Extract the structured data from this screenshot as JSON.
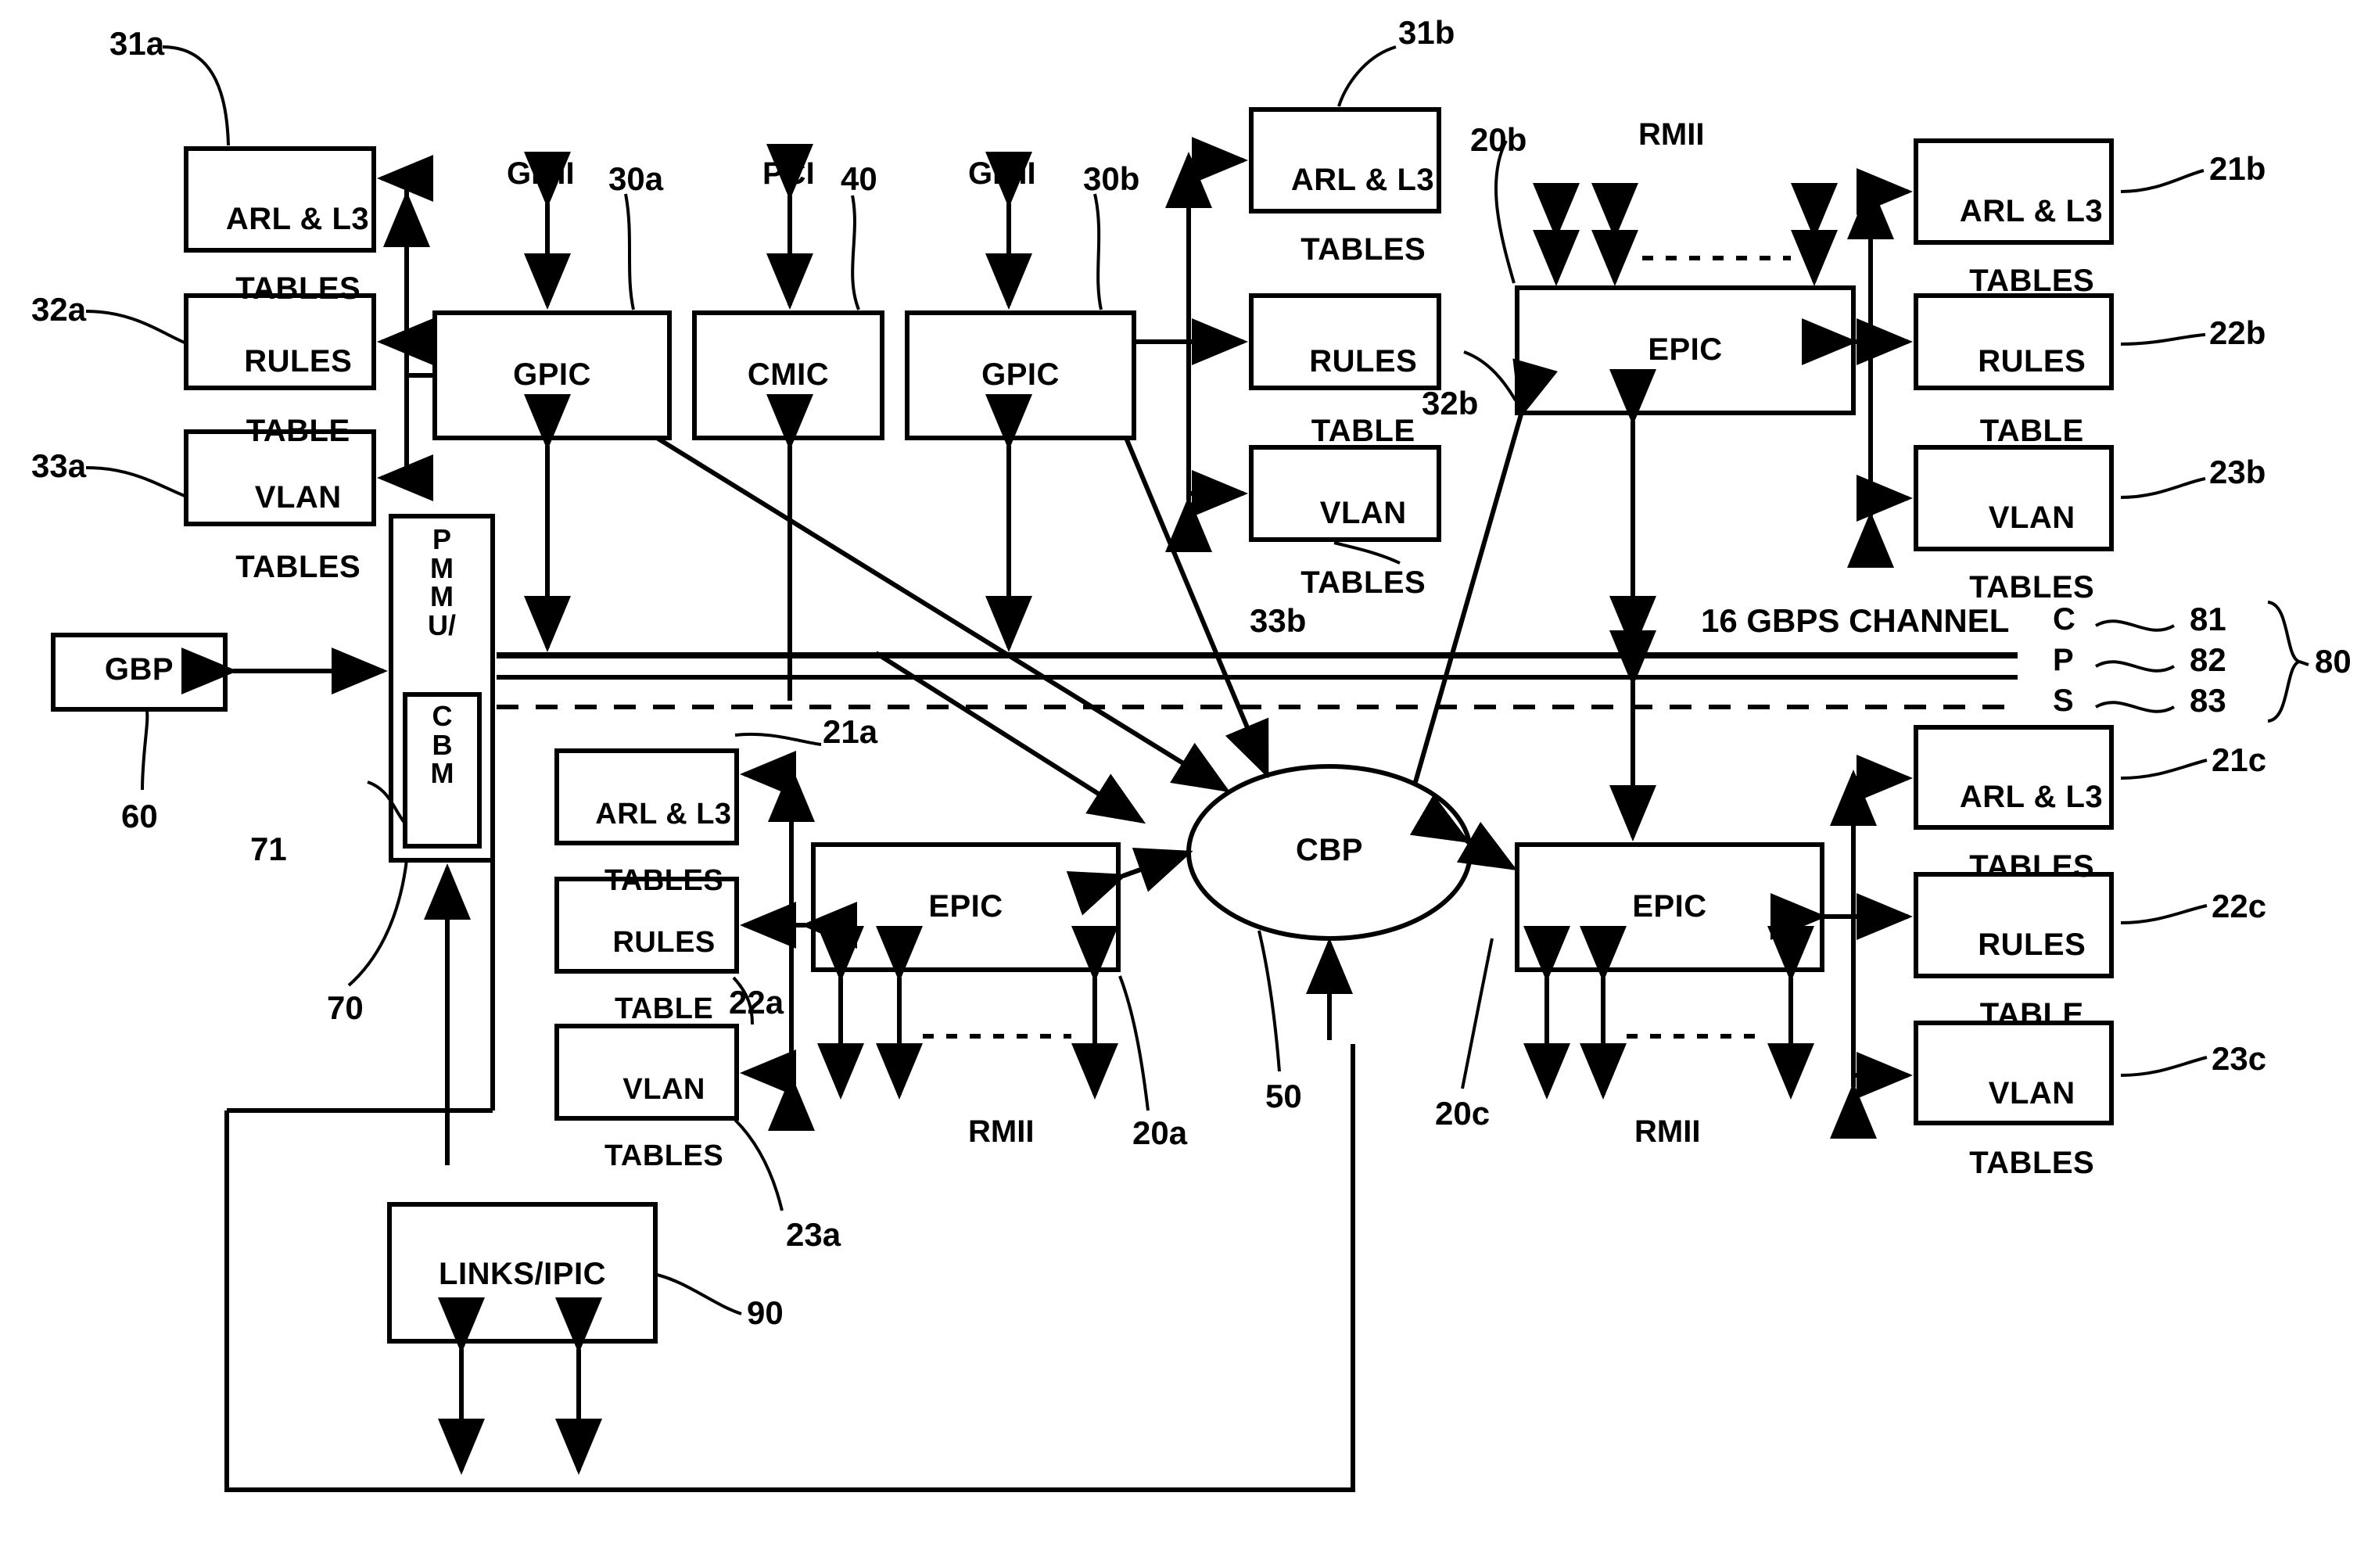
{
  "figure": {
    "type": "patent-block-diagram",
    "background": "#ffffff",
    "stroke": "#000000"
  },
  "blocks": {
    "arl_l3_31a": {
      "line1": "ARL & L3",
      "line2": "TABLES"
    },
    "rules_32a": {
      "line1": "RULES",
      "line2": "TABLE"
    },
    "vlan_33a": {
      "line1": "VLAN",
      "line2": "TABLES"
    },
    "arl_l3_31b": {
      "line1": "ARL & L3",
      "line2": "TABLES"
    },
    "rules_32b": {
      "line1": "RULES",
      "line2": "TABLE"
    },
    "vlan_33b": {
      "line1": "VLAN",
      "line2": "TABLES"
    },
    "arl_l3_21b": {
      "line1": "ARL & L3",
      "line2": "TABLES"
    },
    "rules_22b": {
      "line1": "RULES",
      "line2": "TABLE"
    },
    "vlan_23b": {
      "line1": "VLAN",
      "line2": "TABLES"
    },
    "arl_l3_21a": {
      "line1": "ARL & L3",
      "line2": "TABLES"
    },
    "rules_22a": {
      "line1": "RULES",
      "line2": "TABLE"
    },
    "vlan_23a": {
      "line1": "VLAN",
      "line2": "TABLES"
    },
    "arl_l3_21c": {
      "line1": "ARL & L3",
      "line2": "TABLES"
    },
    "rules_22c": {
      "line1": "RULES",
      "line2": "TABLE"
    },
    "vlan_23c": {
      "line1": "VLAN",
      "line2": "TABLES"
    },
    "gpic_30a": {
      "label": "GPIC"
    },
    "cmic_40": {
      "label": "CMIC"
    },
    "gpic_30b": {
      "label": "GPIC"
    },
    "epic_20a": {
      "label": "EPIC"
    },
    "epic_20b": {
      "label": "EPIC"
    },
    "epic_20c": {
      "label": "EPIC"
    },
    "gbp_60": {
      "label": "GBP"
    },
    "pmmu_70": {
      "label": "P\nM\nM\nU/"
    },
    "cbm_71": {
      "label": "C\nB\nM"
    },
    "links_ipic_90": {
      "label": "LINKS/IPIC"
    },
    "cbp_50": {
      "label": "CBP"
    }
  },
  "interface_labels": {
    "gmii_left": "GMII",
    "pci": "PCI",
    "gmii_right": "GMII",
    "rmii_top_right": "RMII",
    "rmii_bottom_left": "RMII",
    "rmii_bottom_right": "RMII"
  },
  "channel": {
    "title": "16 GBPS CHANNEL",
    "lanes": [
      {
        "letter": "C",
        "ref": "81"
      },
      {
        "letter": "P",
        "ref": "82"
      },
      {
        "letter": "S",
        "ref": "83"
      }
    ],
    "group_ref": "80"
  },
  "reference_numerals": {
    "r31a": "31a",
    "r32a": "32a",
    "r33a": "33a",
    "r30a": "30a",
    "r40": "40",
    "r30b": "30b",
    "r31b": "31b",
    "r32b": "32b",
    "r33b": "33b",
    "r20b": "20b",
    "r21b": "21b",
    "r22b": "22b",
    "r23b": "23b",
    "r60": "60",
    "r70": "70",
    "r71": "71",
    "r21a": "21a",
    "r22a": "22a",
    "r23a": "23a",
    "r20a": "20a",
    "r50": "50",
    "r20c": "20c",
    "r21c": "21c",
    "r22c": "22c",
    "r23c": "23c",
    "r90": "90",
    "r80": "80",
    "r81": "81",
    "r82": "82",
    "r83": "83"
  }
}
